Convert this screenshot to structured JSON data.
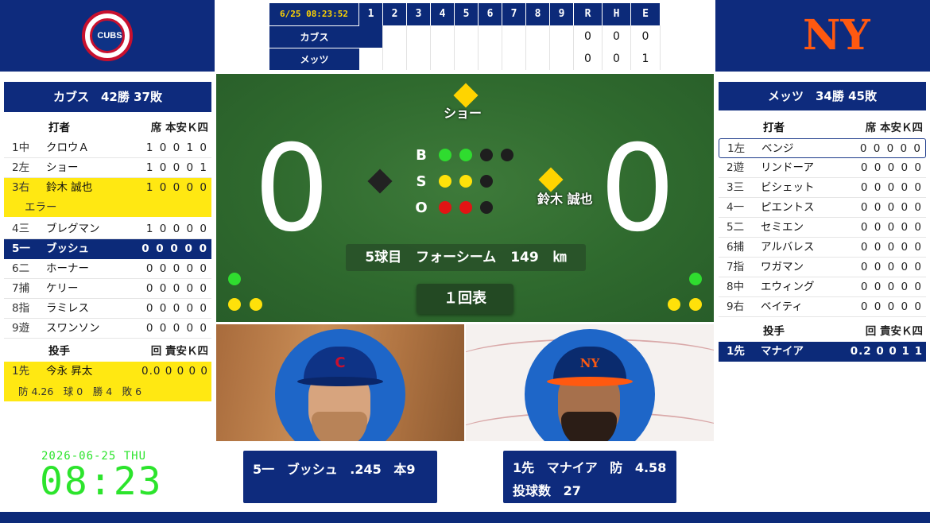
{
  "linescore": {
    "datetime": "6/25 08:23:52",
    "innings": [
      "1",
      "2",
      "3",
      "4",
      "5",
      "6",
      "7",
      "8",
      "9"
    ],
    "totals_headers": [
      "R",
      "H",
      "E"
    ],
    "teams": [
      {
        "name": "カブス",
        "runs": "0",
        "hits": "0",
        "errors": "0"
      },
      {
        "name": "メッツ",
        "runs": "0",
        "hits": "0",
        "errors": "1"
      }
    ]
  },
  "logos": {
    "away": "cubs-logo",
    "home": "mets-logo",
    "away_text": "CUBS",
    "home_text": "NY"
  },
  "away_panel": {
    "header": "カブス　42勝 37敗",
    "batter_head": "打者",
    "stat_head": "席 本安Ｋ四",
    "batters": [
      {
        "pos": "1中",
        "name": "クロウＡ",
        "stats": "1 0 0 1 0"
      },
      {
        "pos": "2左",
        "name": "ショー",
        "stats": "1 0 0 0 1"
      },
      {
        "pos": "3右",
        "name": "鈴木 誠也",
        "stats": "1 0 0 0 0"
      },
      {
        "pos": "4三",
        "name": "ブレグマン",
        "stats": "1 0 0 0 0"
      },
      {
        "pos": "5一",
        "name": "ブッシュ",
        "stats": "0 0 0 0 0"
      },
      {
        "pos": "6二",
        "name": "ホーナー",
        "stats": "0 0 0 0 0"
      },
      {
        "pos": "7捕",
        "name": "ケリー",
        "stats": "0 0 0 0 0"
      },
      {
        "pos": "8指",
        "name": "ラミレス",
        "stats": "0 0 0 0 0"
      },
      {
        "pos": "9遊",
        "name": "スワンソン",
        "stats": "0 0 0 0 0"
      }
    ],
    "error_note": "エラー",
    "pitcher_head": "投手",
    "pitcher_stat_head": "回 責安Ｋ四",
    "pitcher": {
      "pos": "1先",
      "name": "今永 昇太",
      "stats": "0.0 0 0 0 0"
    },
    "pitcher_line": "防 4.26　球 0　勝 4　敗 6"
  },
  "home_panel": {
    "header": "メッツ　34勝 45敗",
    "batter_head": "打者",
    "stat_head": "席 本安Ｋ四",
    "batters": [
      {
        "pos": "1左",
        "name": "ベンジ",
        "stats": "0 0 0 0 0"
      },
      {
        "pos": "2遊",
        "name": "リンドーア",
        "stats": "0 0 0 0 0"
      },
      {
        "pos": "3三",
        "name": "ビシェット",
        "stats": "0 0 0 0 0"
      },
      {
        "pos": "4一",
        "name": "ピエントス",
        "stats": "0 0 0 0 0"
      },
      {
        "pos": "5二",
        "name": "セミエン",
        "stats": "0 0 0 0 0"
      },
      {
        "pos": "6捕",
        "name": "アルバレス",
        "stats": "0 0 0 0 0"
      },
      {
        "pos": "7指",
        "name": "ワガマン",
        "stats": "0 0 0 0 0"
      },
      {
        "pos": "8中",
        "name": "エウィング",
        "stats": "0 0 0 0 0"
      },
      {
        "pos": "9右",
        "name": "ベイティ",
        "stats": "0 0 0 0 0"
      }
    ],
    "pitcher_head": "投手",
    "pitcher_stat_head": "回 責安Ｋ四",
    "pitcher": {
      "pos": "1先",
      "name": "マナイア",
      "stats": "0.2 0 0 1 1"
    }
  },
  "field": {
    "away_score": "0",
    "home_score": "0",
    "count_labels": [
      "B",
      "S",
      "O"
    ],
    "balls": 2,
    "strikes": 2,
    "outs": 2,
    "runner_second": "ショー",
    "runner_first": "鈴木 誠也",
    "pitch_info": "5球目 フォーシーム 149 ㎞",
    "inning": "１回表",
    "colors": {
      "ball": "#2fdc2f",
      "strike": "#ffe10a",
      "out": "#e21414",
      "base_occupied": "#ffd400",
      "base_empty": "#222222"
    }
  },
  "batter_box": {
    "line1": "5一 ブッシュ .245 本9"
  },
  "pitcher_box": {
    "line1": "1先 マナイア 防 4.58",
    "line2": "投球数 27"
  },
  "clock": {
    "date": "2026-06-25 THU",
    "time": "08:23"
  }
}
